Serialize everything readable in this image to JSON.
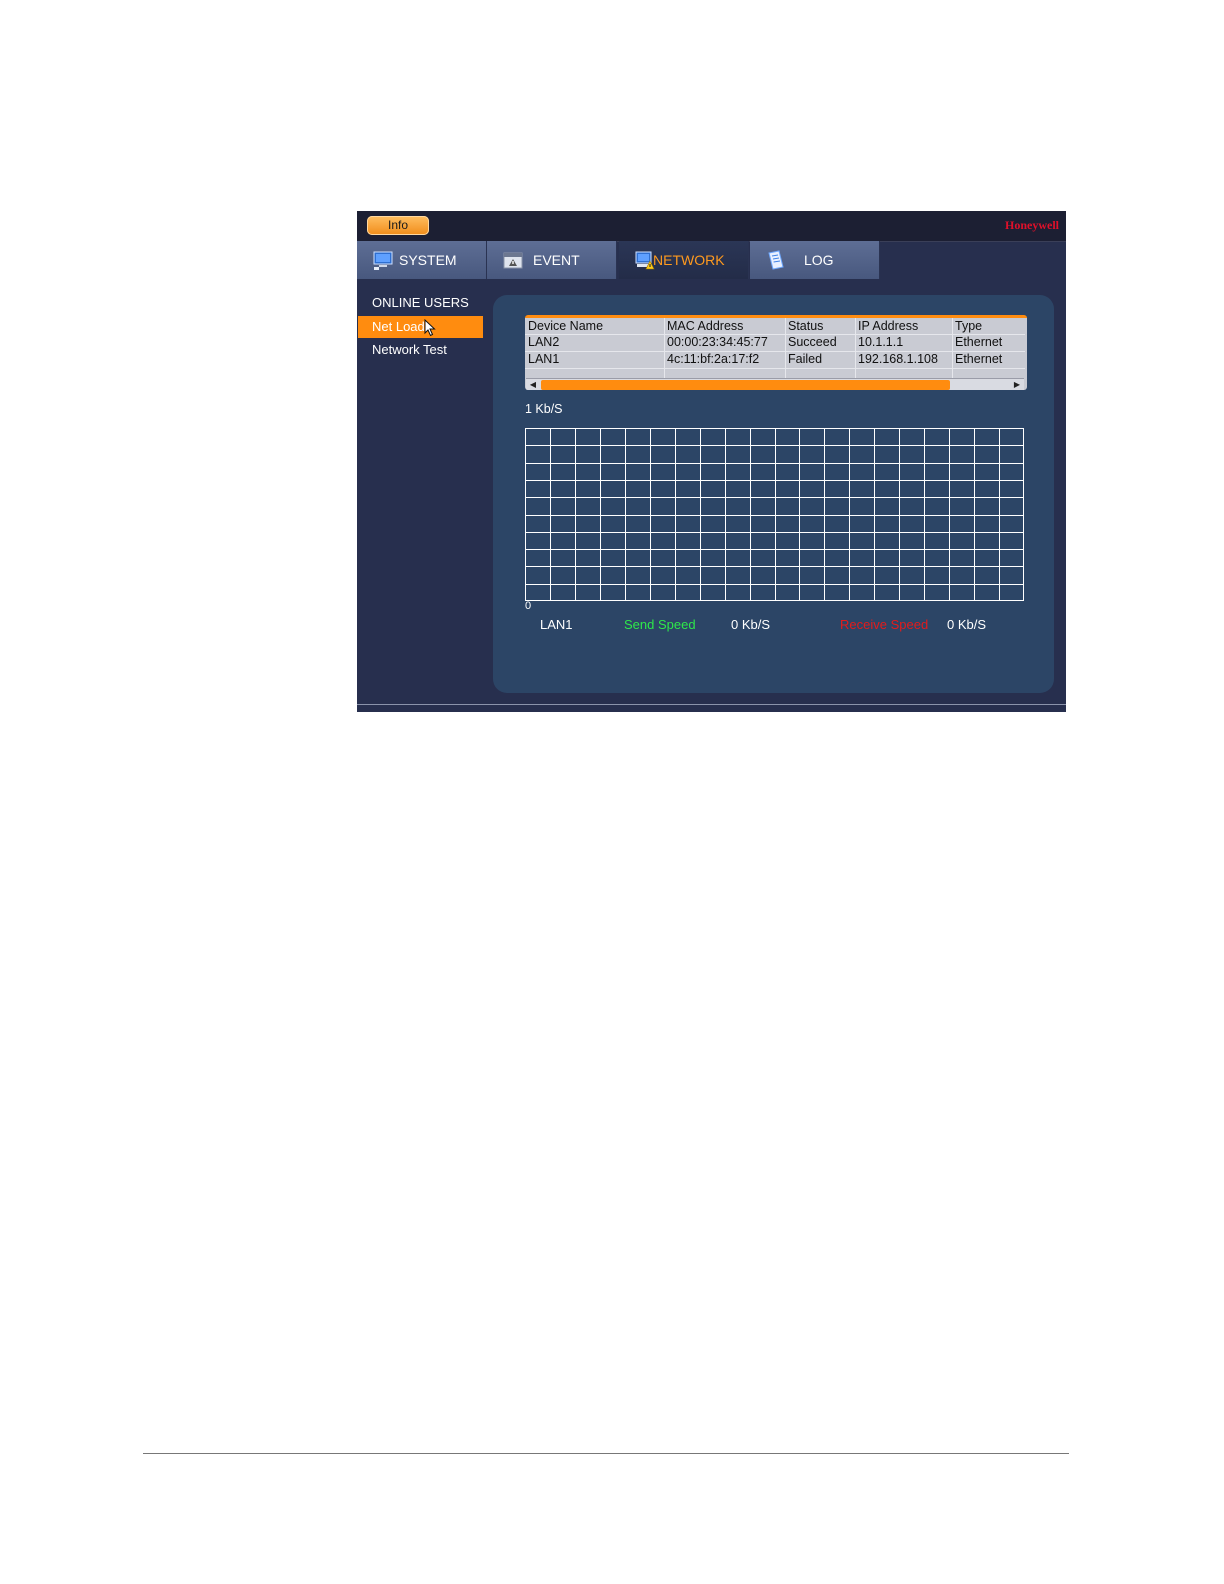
{
  "header": {
    "info_label": "Info",
    "brand": "Honeywell"
  },
  "tabs": [
    {
      "label": "SYSTEM",
      "icon": "monitor-icon"
    },
    {
      "label": "EVENT",
      "icon": "event-icon"
    },
    {
      "label": "NETWORK",
      "icon": "network-icon",
      "active": true
    },
    {
      "label": "LOG",
      "icon": "log-icon"
    }
  ],
  "sidebar": {
    "items": [
      {
        "label": "ONLINE USERS"
      },
      {
        "label": "Net Load",
        "active": true
      },
      {
        "label": "Network Test"
      }
    ]
  },
  "table": {
    "columns": [
      "Device Name",
      "MAC Address",
      "Status",
      "IP Address",
      "Type"
    ],
    "rows": [
      [
        "LAN2",
        "00:00:23:34:45:77",
        "Succeed",
        "10.1.1.1",
        "Ethernet"
      ],
      [
        "LAN1",
        "4c:11:bf:2a:17:f2",
        "Failed",
        "192.168.1.108",
        "Ethernet"
      ]
    ]
  },
  "graph": {
    "y_max_label": "1 Kb/S",
    "y_min_label": "0",
    "grid_columns": 20,
    "grid_rows": 10
  },
  "legend": {
    "device": "LAN1",
    "send_label": "Send Speed",
    "send_value": "0 Kb/S",
    "receive_label": "Receive Speed",
    "receive_value": "0 Kb/S"
  },
  "colors": {
    "accent": "#ff8c0f",
    "send": "#2ee84a",
    "receive": "#e31b1b",
    "brand": "#e0102a"
  }
}
